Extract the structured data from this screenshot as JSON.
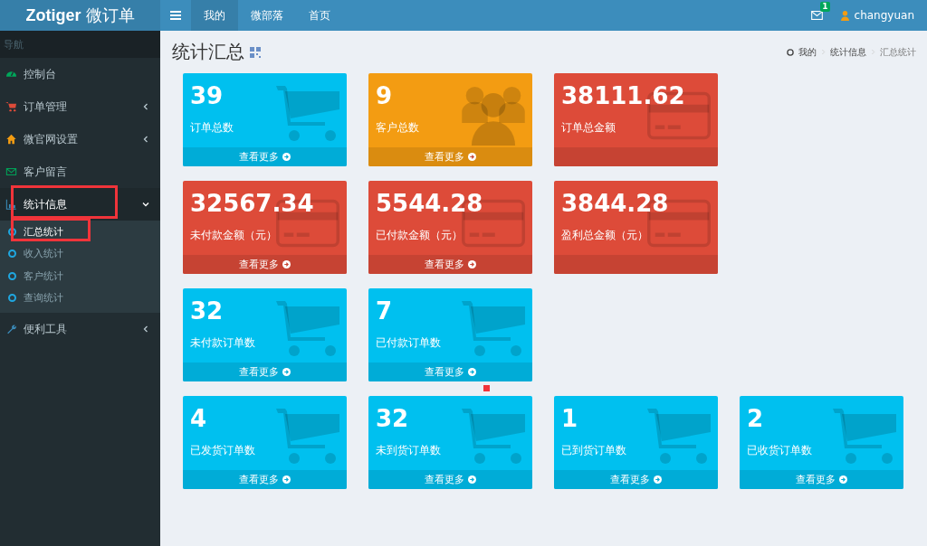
{
  "header": {
    "logo_brand": "Zotiger",
    "logo_suffix": "微订单",
    "nav": [
      {
        "label": "我的",
        "selected": true
      },
      {
        "label": "微部落",
        "selected": false
      },
      {
        "label": "首页",
        "selected": false
      }
    ],
    "mail_badge": "1",
    "user": "changyuan"
  },
  "sidebar": {
    "header": "导航",
    "items": [
      {
        "label": "控制台",
        "expandable": false,
        "expanded": false,
        "highlighted": false
      },
      {
        "label": "订单管理",
        "expandable": true,
        "expanded": false,
        "highlighted": false
      },
      {
        "label": "微官网设置",
        "expandable": true,
        "expanded": false,
        "highlighted": false
      },
      {
        "label": "客户留言",
        "expandable": false,
        "expanded": false,
        "highlighted": false
      },
      {
        "label": "统计信息",
        "expandable": true,
        "expanded": true,
        "highlighted": true,
        "children": [
          {
            "label": "汇总统计",
            "selected": true,
            "highlighted": true
          },
          {
            "label": "收入统计",
            "selected": false,
            "highlighted": false
          },
          {
            "label": "客户统计",
            "selected": false,
            "highlighted": false
          },
          {
            "label": "查询统计",
            "selected": false,
            "highlighted": false
          }
        ]
      },
      {
        "label": "便利工具",
        "expandable": true,
        "expanded": false,
        "highlighted": false
      }
    ]
  },
  "page": {
    "title": "统计汇总",
    "breadcrumb": [
      "我的",
      "统计信息",
      "汇总统计"
    ]
  },
  "card_rows": [
    [
      {
        "value": "39",
        "label": "订单总数",
        "link": "查看更多",
        "kind": "aqua"
      },
      {
        "value": "9",
        "label": "客户总数",
        "link": "查看更多",
        "kind": "orange"
      },
      {
        "value": "38111.62",
        "label": "订单总金额",
        "kind": "red"
      }
    ],
    [
      {
        "value": "32567.34",
        "label": "未付款金额（元）",
        "link": "查看更多",
        "kind": "red"
      },
      {
        "value": "5544.28",
        "label": "已付款金额（元）",
        "link": "查看更多",
        "kind": "red"
      },
      {
        "value": "3844.28",
        "label": "盈利总金额（元）",
        "kind": "red"
      }
    ],
    [
      {
        "value": "32",
        "label": "未付款订单数",
        "link": "查看更多",
        "kind": "aqua"
      },
      {
        "value": "7",
        "label": "已付款订单数",
        "link": "查看更多",
        "kind": "aqua"
      }
    ],
    [
      {
        "value": "4",
        "label": "已发货订单数",
        "link": "查看更多",
        "kind": "aqua"
      },
      {
        "value": "32",
        "label": "未到货订单数",
        "link": "查看更多",
        "kind": "aqua"
      },
      {
        "value": "1",
        "label": "已到货订单数",
        "link": "查看更多",
        "kind": "aqua"
      },
      {
        "value": "2",
        "label": "已收货订单数",
        "link": "查看更多",
        "kind": "aqua"
      }
    ]
  ],
  "marker_dot": true
}
